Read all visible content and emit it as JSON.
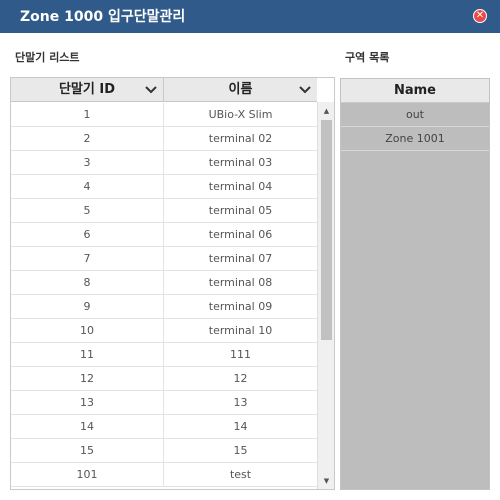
{
  "dialog": {
    "title": "Zone 1000 입구단말관리",
    "close_symbol": "✕"
  },
  "terminals": {
    "section_label": "단말기 리스트",
    "columns": [
      "단말기 ID",
      "이름"
    ],
    "rows": [
      {
        "id": "1",
        "name": "UBio-X Slim"
      },
      {
        "id": "2",
        "name": "terminal 02"
      },
      {
        "id": "3",
        "name": "terminal 03"
      },
      {
        "id": "4",
        "name": "terminal 04"
      },
      {
        "id": "5",
        "name": "terminal 05"
      },
      {
        "id": "6",
        "name": "terminal 06"
      },
      {
        "id": "7",
        "name": "terminal 07"
      },
      {
        "id": "8",
        "name": "terminal 08"
      },
      {
        "id": "9",
        "name": "terminal 09"
      },
      {
        "id": "10",
        "name": "terminal 10"
      },
      {
        "id": "11",
        "name": "111"
      },
      {
        "id": "12",
        "name": "12"
      },
      {
        "id": "13",
        "name": "13"
      },
      {
        "id": "14",
        "name": "14"
      },
      {
        "id": "15",
        "name": "15"
      },
      {
        "id": "101",
        "name": "test"
      }
    ]
  },
  "zones": {
    "section_label": "구역 목록",
    "column": "Name",
    "rows": [
      "out",
      "Zone 1001"
    ]
  },
  "icons": {
    "sort": "chevron-down-icon",
    "close": "close-icon",
    "scroll_up": "scroll-up-arrow-icon",
    "scroll_down": "scroll-down-arrow-icon"
  },
  "colors": {
    "titlebar": "#2f5a8a",
    "close": "#e84a4a",
    "zone_bg": "#bdbdbd",
    "header_bg": "#e9e9e9"
  }
}
